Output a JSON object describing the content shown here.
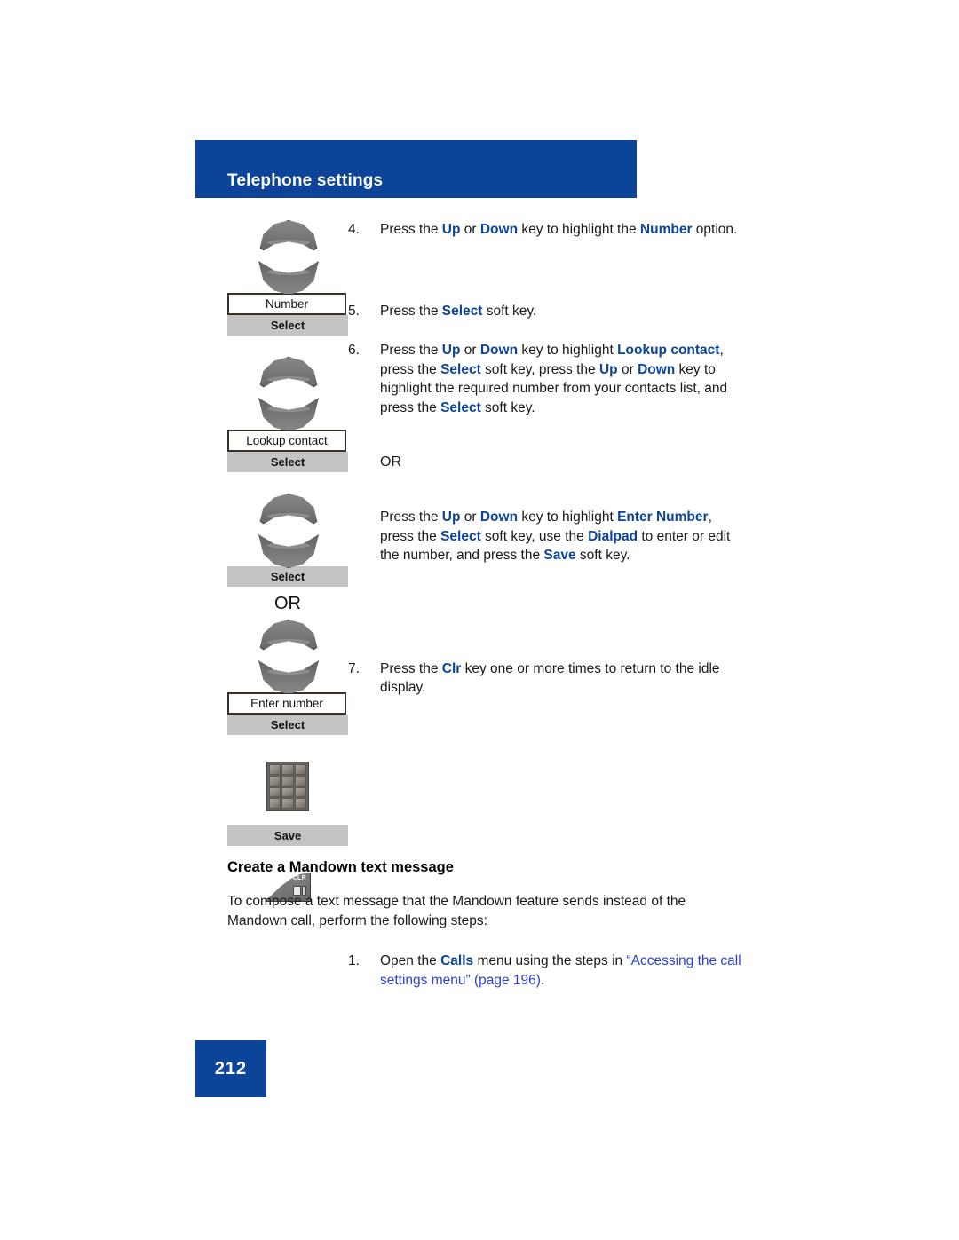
{
  "header": {
    "title": "Telephone settings",
    "bar_color": "#0B4499"
  },
  "accent_color": "#0B4499",
  "link_color": "#2b3fd6",
  "icons": {
    "nav_up": "navigation-up-key-icon",
    "nav_down": "navigation-down-key-icon",
    "dialpad": "dialpad-icon",
    "clr_key": "clr-key-icon",
    "clr_key_label": "CLR"
  },
  "icon_column": {
    "group_number": {
      "label_box": "Number",
      "softkey": "Select"
    },
    "group_lookup": {
      "label_box": "Lookup contact",
      "softkey": "Select"
    },
    "group_select_only": {
      "softkey": "Select"
    },
    "or_separator": "OR",
    "group_enter_number": {
      "label_box": "Enter number",
      "softkey": "Select"
    },
    "group_dialpad": {
      "softkey": "Save"
    }
  },
  "steps": {
    "step4": {
      "num": "4.",
      "parts": [
        {
          "t": "Press the ",
          "kw": false
        },
        {
          "t": "Up",
          "kw": true
        },
        {
          "t": " or ",
          "kw": false
        },
        {
          "t": "Down",
          "kw": true
        },
        {
          "t": " key to highlight the ",
          "kw": false
        },
        {
          "t": "Number",
          "kw": true
        },
        {
          "t": " option.",
          "kw": false
        }
      ]
    },
    "step5": {
      "num": "5.",
      "parts": [
        {
          "t": "Press the ",
          "kw": false
        },
        {
          "t": "Select",
          "kw": true
        },
        {
          "t": " soft key.",
          "kw": false
        }
      ]
    },
    "step6": {
      "num": "6.",
      "parts": [
        {
          "t": "Press the ",
          "kw": false
        },
        {
          "t": "Up",
          "kw": true
        },
        {
          "t": " or ",
          "kw": false
        },
        {
          "t": "Down",
          "kw": true
        },
        {
          "t": " key to highlight ",
          "kw": false
        },
        {
          "t": "Lookup contact",
          "kw": true
        },
        {
          "t": ", press the ",
          "kw": false
        },
        {
          "t": "Select",
          "kw": true
        },
        {
          "t": " soft key, press the ",
          "kw": false
        },
        {
          "t": "Up",
          "kw": true
        },
        {
          "t": " or ",
          "kw": false
        },
        {
          "t": "Down",
          "kw": true
        },
        {
          "t": " key to highlight the required number from your contacts list, and press the ",
          "kw": false
        },
        {
          "t": "Select",
          "kw": true
        },
        {
          "t": " soft key.",
          "kw": false
        }
      ]
    },
    "or_right": "OR",
    "alt_para": {
      "parts": [
        {
          "t": "Press the ",
          "kw": false
        },
        {
          "t": "Up",
          "kw": true
        },
        {
          "t": " or ",
          "kw": false
        },
        {
          "t": "Down",
          "kw": true
        },
        {
          "t": " key to highlight ",
          "kw": false
        },
        {
          "t": "Enter Number",
          "kw": true
        },
        {
          "t": ", press the ",
          "kw": false
        },
        {
          "t": "Select",
          "kw": true
        },
        {
          "t": " soft key, use the ",
          "kw": false
        },
        {
          "t": "Dialpad",
          "kw": true
        },
        {
          "t": " to enter or edit the number, and press the ",
          "kw": false
        },
        {
          "t": "Save",
          "kw": true
        },
        {
          "t": " soft key.",
          "kw": false
        }
      ]
    },
    "step7": {
      "num": "7.",
      "parts": [
        {
          "t": "Press the ",
          "kw": false
        },
        {
          "t": "Clr",
          "kw": true
        },
        {
          "t": " key one or more times to return to the idle display.",
          "kw": false
        }
      ]
    }
  },
  "section": {
    "heading": "Create a Mandown text message",
    "intro": "To compose a text message that the Mandown feature sends instead of the Mandown call, perform the following steps:",
    "step1": {
      "num": "1.",
      "parts": [
        {
          "t": "Open the ",
          "kw": false
        },
        {
          "t": "Calls",
          "kw": true
        },
        {
          "t": " menu using the steps in ",
          "kw": false
        },
        {
          "t": "“Accessing the call settings menu” (page 196)",
          "link": true
        },
        {
          "t": ".",
          "kw": false
        }
      ]
    }
  },
  "footer": {
    "page_number": "212"
  }
}
